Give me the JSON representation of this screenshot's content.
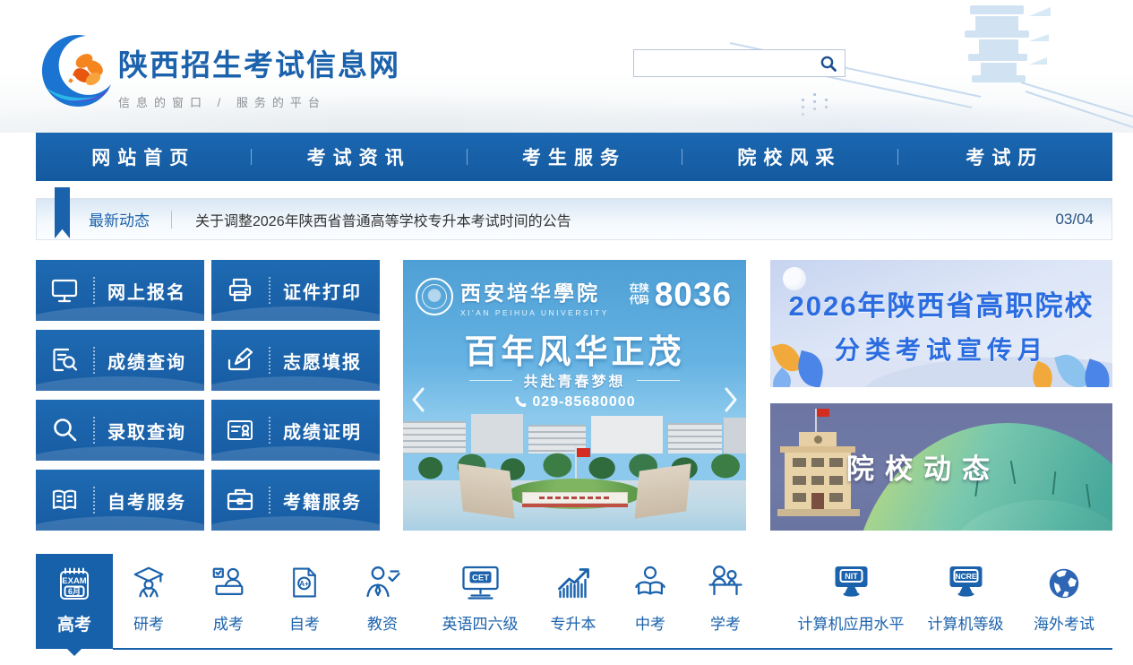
{
  "colors": {
    "primary_blue": "#1b62ac",
    "bar_blue": "#1760aa",
    "banner_text_blue": "#2b6ce0",
    "accent_orange": "#f5861f",
    "flag_red": "#d22c23"
  },
  "header": {
    "site_title": "陕西招生考试信息网",
    "site_slogan": "信息的窗口 / 服务的平台",
    "search": {
      "value": "",
      "placeholder": ""
    }
  },
  "nav": {
    "items": [
      {
        "label": "网站首页"
      },
      {
        "label": "考试资讯"
      },
      {
        "label": "考生服务"
      },
      {
        "label": "院校风采"
      },
      {
        "label": "考试历"
      }
    ]
  },
  "ticker": {
    "label": "最新动态",
    "headline": "关于调整2026年陕西省普通高等学校专升本考试时间的公告",
    "date": "03/04"
  },
  "quick_links": [
    {
      "label": "网上报名",
      "icon": "monitor-icon"
    },
    {
      "label": "证件打印",
      "icon": "printer-icon"
    },
    {
      "label": "成绩查询",
      "icon": "score-search-icon"
    },
    {
      "label": "志愿填报",
      "icon": "pencil-form-icon"
    },
    {
      "label": "录取查询",
      "icon": "magnifier-icon"
    },
    {
      "label": "成绩证明",
      "icon": "certificate-icon"
    },
    {
      "label": "自考服务",
      "icon": "open-book-icon"
    },
    {
      "label": "考籍服务",
      "icon": "briefcase-icon"
    }
  ],
  "carousel": {
    "university_name": "西安培华學院",
    "university_name_en": "XI'AN PEIHUA UNIVERSITY",
    "code_label_top": "在陕",
    "code_label_bottom": "代码",
    "code_value": "8036",
    "slogan_main": "百年风华正茂",
    "slogan_sub": "共赴青春梦想",
    "phone": "029-85680000"
  },
  "banners": {
    "promo": {
      "line1": "2026年陕西省高职院校",
      "line2": "分类考试宣传月"
    },
    "news": {
      "title": "院校动态"
    }
  },
  "categories": [
    {
      "label": "高考",
      "icon": "exam-calendar-icon",
      "icon_text_top": "EXAM",
      "icon_text_bottom": "6月",
      "active": true
    },
    {
      "label": "研考",
      "icon": "graduate-icon"
    },
    {
      "label": "成考",
      "icon": "adult-exam-icon"
    },
    {
      "label": "自考",
      "icon": "self-study-icon",
      "icon_text": "A+"
    },
    {
      "label": "教资",
      "icon": "teacher-cert-icon"
    },
    {
      "label": "英语四六级",
      "icon": "cet-monitor-icon",
      "icon_text": "CET"
    },
    {
      "label": "专升本",
      "icon": "growth-chart-icon"
    },
    {
      "label": "中考",
      "icon": "reading-student-icon"
    },
    {
      "label": "学考",
      "icon": "classroom-icon"
    },
    {
      "label": "计算机应用水平",
      "icon": "nit-monitor-icon",
      "icon_text": "NIT"
    },
    {
      "label": "计算机等级",
      "icon": "ncre-monitor-icon",
      "icon_text": "NCRE"
    },
    {
      "label": "海外考试",
      "icon": "globe-icon"
    }
  ]
}
